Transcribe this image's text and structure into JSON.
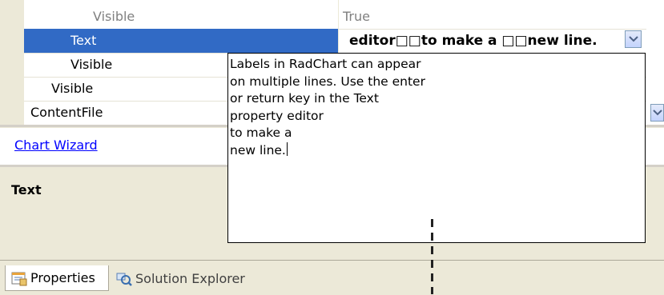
{
  "property_grid": {
    "rows": [
      {
        "name": "Visible",
        "value": "True",
        "state": "dim"
      },
      {
        "name": "Text",
        "value": "editor□□to make a □□new line.",
        "state": "selected"
      },
      {
        "name": "Visible",
        "value": "",
        "state": "normal"
      },
      {
        "name": "Visible",
        "value": "",
        "state": "normal"
      },
      {
        "name": "ContentFile",
        "value": "",
        "state": "normal"
      }
    ]
  },
  "commands": {
    "chart_wizard_label": "Chart Wizard"
  },
  "description": {
    "title": "Text"
  },
  "text_editor": {
    "lines": [
      "Labels in RadChart can appear",
      "on multiple lines. Use the enter",
      "or return key in the Text",
      "property editor",
      "to make a",
      "new line."
    ]
  },
  "tabs": [
    {
      "label": "Properties",
      "icon": "properties-icon",
      "active": true
    },
    {
      "label": "Solution Explorer",
      "icon": "solution-explorer-icon",
      "active": false
    }
  ],
  "colors": {
    "selection": "#316ac5",
    "link": "#0000ff",
    "panel": "#ece9d8"
  }
}
